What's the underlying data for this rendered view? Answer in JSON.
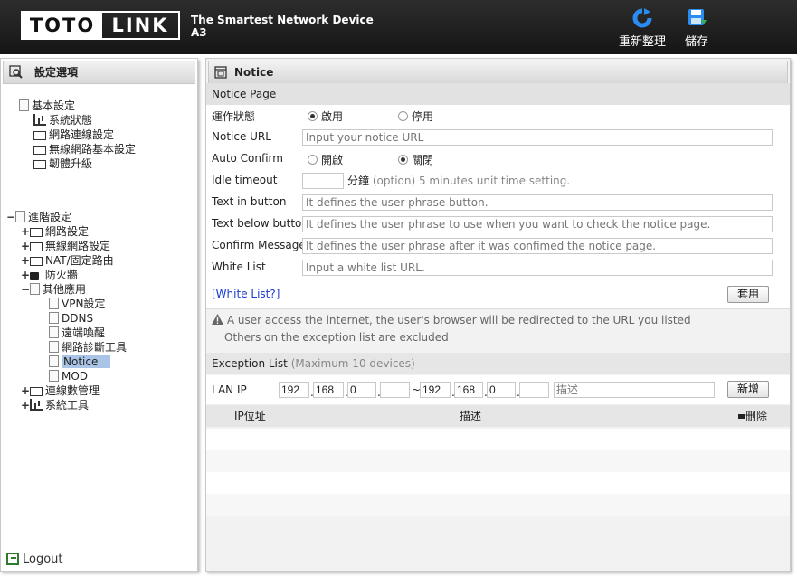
{
  "header": {
    "brand_left": "TOTO",
    "brand_right": "LINK",
    "tagline": "The Smartest Network Device",
    "model": "A3",
    "refresh_label": "重新整理",
    "save_label": "儲存"
  },
  "sidebar": {
    "title": "設定選項",
    "basic": {
      "label": "基本設定",
      "items": [
        "系統狀態",
        "網路連線設定",
        "無線網路基本設定",
        "韌體升級"
      ]
    },
    "advanced": {
      "label": "進階設定",
      "items": [
        "網路設定",
        "無線網路設定",
        "NAT/固定路由",
        "防火牆",
        "其他應用"
      ],
      "other_apps": [
        "VPN設定",
        "DDNS",
        "遠端喚醒",
        "網路診斷工具",
        "Notice",
        "MOD"
      ],
      "more": [
        "連線數管理",
        "系統工具"
      ]
    },
    "logout": "Logout"
  },
  "main": {
    "title": "Notice",
    "section_label": "Notice Page",
    "status": {
      "label": "運作狀態",
      "enable": "啟用",
      "disable": "停用",
      "value": "enable"
    },
    "notice_url": {
      "label": "Notice URL",
      "placeholder": "Input your notice URL"
    },
    "auto_confirm": {
      "label": "Auto Confirm",
      "on": "開啟",
      "off": "關閉",
      "value": "off"
    },
    "idle_timeout": {
      "label": "Idle timeout",
      "value": "",
      "unit": "分鐘",
      "hint": "(option) 5 minutes unit time setting."
    },
    "text_in_button": {
      "label": "Text in button",
      "placeholder": "It defines the user phrase button."
    },
    "text_below_button": {
      "label": "Text below button",
      "placeholder": "It defines the user phrase to use when you want to check the notice page."
    },
    "confirm_message": {
      "label": "Confirm Message",
      "placeholder": "It defines the user phrase after it was confimed the notice page."
    },
    "white_list": {
      "label": "White List",
      "placeholder": "Input a white list URL."
    },
    "white_list_link": "[White List?]",
    "apply_button": "套用",
    "notice_line1": "A user access the internet, the user's browser will be redirected to the URL you listed",
    "notice_line2": "Others on the exception list are excluded",
    "exception": {
      "title": "Exception List",
      "subtitle": "(Maximum 10 devices)",
      "lan_ip_label": "LAN IP",
      "start_ip": [
        "192",
        "168",
        "0",
        ""
      ],
      "end_ip": [
        "192",
        "168",
        "0",
        ""
      ],
      "tilde": "~",
      "desc_placeholder": "描述",
      "add_button": "新增",
      "columns": {
        "ip": "IP位址",
        "desc": "描述",
        "delete": "刪除"
      }
    }
  }
}
